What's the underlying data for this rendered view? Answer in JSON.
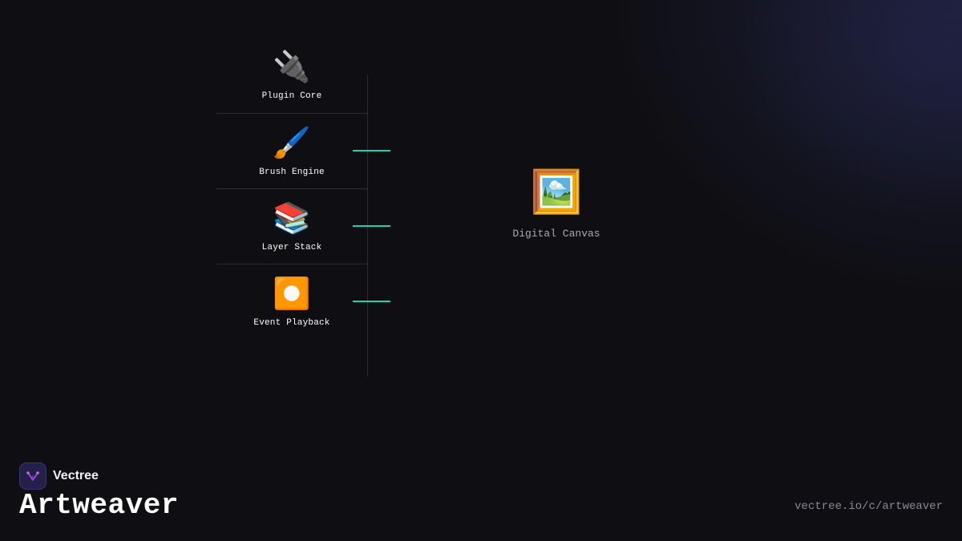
{
  "diagram": {
    "modules": [
      {
        "id": "plugin-core",
        "icon": "🔌",
        "icon_name": "plug-icon",
        "label": "Plugin Core",
        "connected": false
      },
      {
        "id": "brush-engine",
        "icon": "🖌️",
        "icon_name": "paintbrush-icon",
        "label": "Brush Engine",
        "connected": true
      },
      {
        "id": "layer-stack",
        "icon": "📚",
        "icon_name": "books-icon",
        "label": "Layer Stack",
        "connected": true
      },
      {
        "id": "event-playback",
        "icon": "⏺️",
        "icon_name": "record-button-icon",
        "label": "Event Playback",
        "connected": true
      }
    ],
    "target": {
      "icon": "🖼️",
      "icon_name": "framed-picture-icon",
      "label": "Digital Canvas"
    },
    "connector_color": "#19d3b2"
  },
  "footer": {
    "brand_name": "Vectree",
    "logo_icon": "vectree-logo-icon",
    "project_title": "Artweaver",
    "url": "vectree.io/c/artweaver"
  }
}
